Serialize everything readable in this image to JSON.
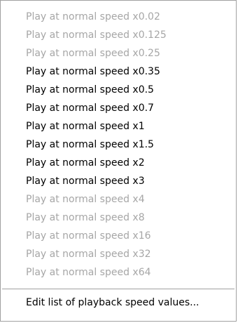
{
  "menu": {
    "items": [
      {
        "label": "Play at normal speed x0.02",
        "enabled": false
      },
      {
        "label": "Play at normal speed x0.125",
        "enabled": false
      },
      {
        "label": "Play at normal speed x0.25",
        "enabled": false
      },
      {
        "label": "Play at normal speed x0.35",
        "enabled": true
      },
      {
        "label": "Play at normal speed x0.5",
        "enabled": true
      },
      {
        "label": "Play at normal speed x0.7",
        "enabled": true
      },
      {
        "label": "Play at normal speed x1",
        "enabled": true
      },
      {
        "label": "Play at normal speed x1.5",
        "enabled": true
      },
      {
        "label": "Play at normal speed x2",
        "enabled": true
      },
      {
        "label": "Play at normal speed x3",
        "enabled": true
      },
      {
        "label": "Play at normal speed x4",
        "enabled": false
      },
      {
        "label": "Play at normal speed x8",
        "enabled": false
      },
      {
        "label": "Play at normal speed x16",
        "enabled": false
      },
      {
        "label": "Play at normal speed x32",
        "enabled": false
      },
      {
        "label": "Play at normal speed x64",
        "enabled": false
      }
    ],
    "edit_label": "Edit list of playback speed values...",
    "colors": {
      "enabled_text": "#000000",
      "disabled_text": "#a6a6a6",
      "border": "#a0a0a0",
      "background": "#ffffff"
    }
  }
}
